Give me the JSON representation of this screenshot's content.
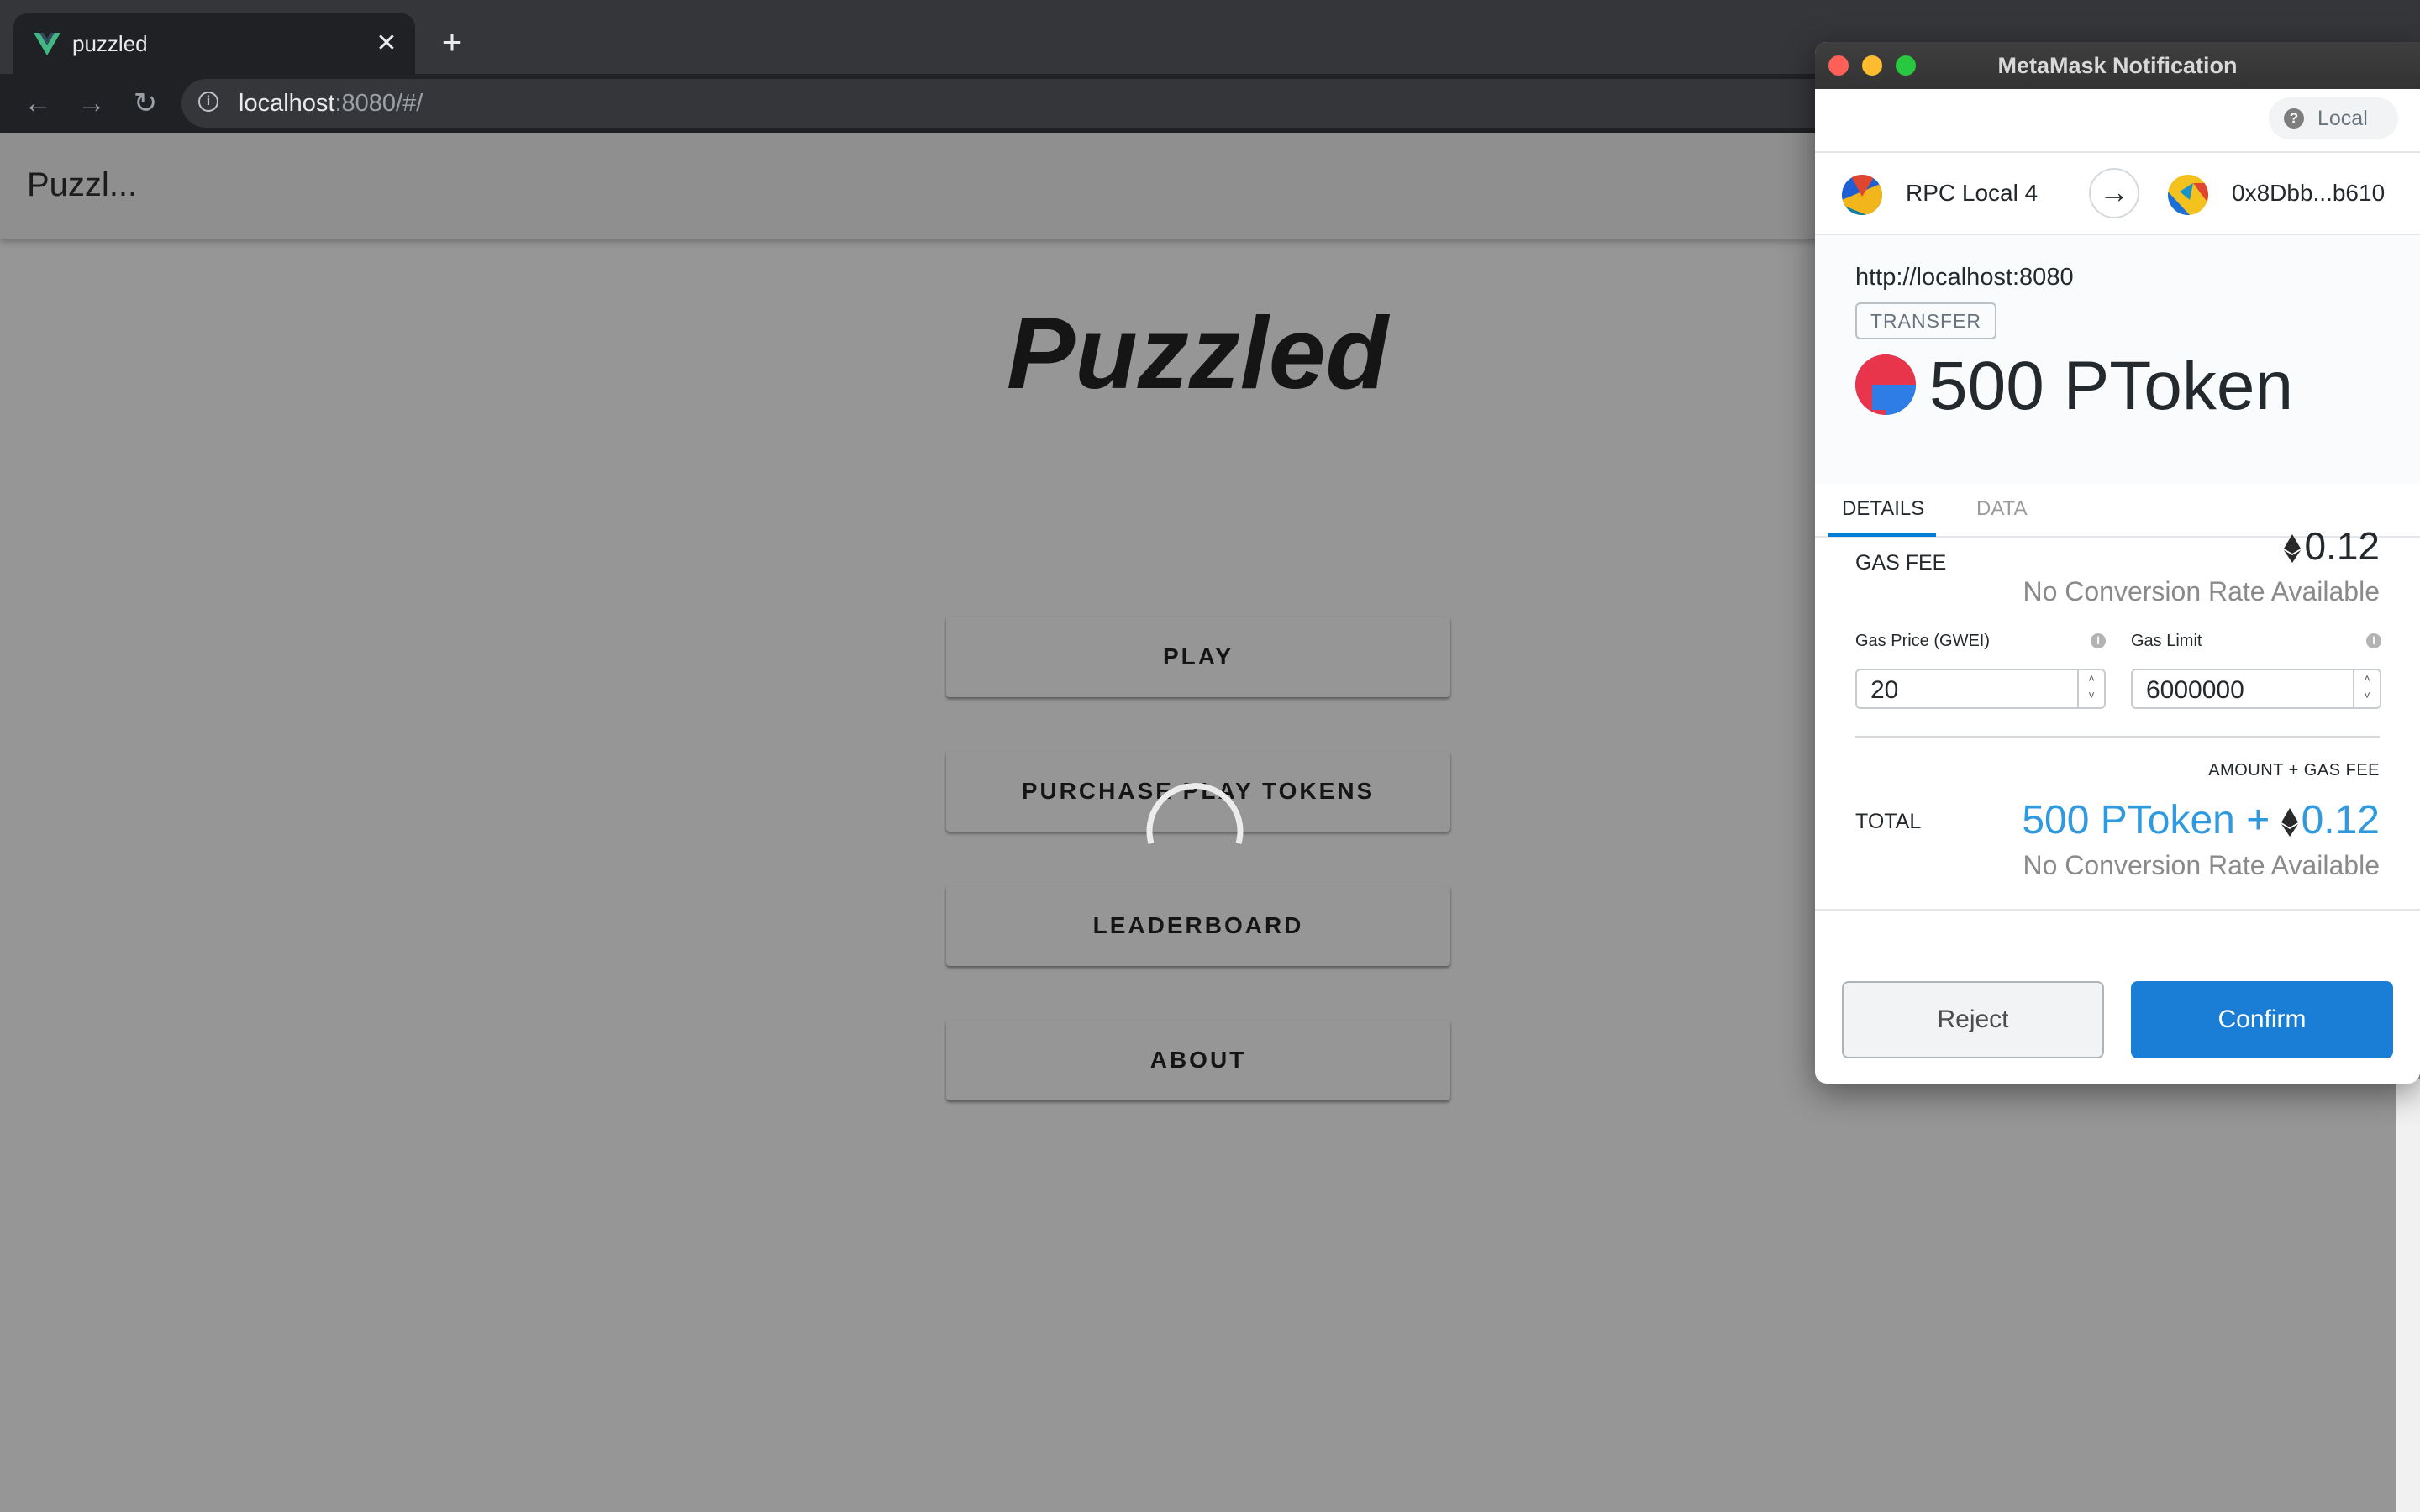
{
  "browser": {
    "tab_title": "puzzled",
    "close_glyph": "✕",
    "new_tab_glyph": "+",
    "url_host": "localhost",
    "url_rest": ":8080/#/",
    "nav": {
      "back": "←",
      "forward": "→",
      "reload": "↻"
    },
    "icons": [
      "vue-logo-icon",
      "close-icon",
      "plus-icon",
      "back-arrow-icon",
      "forward-arrow-icon",
      "reload-icon",
      "info-icon"
    ]
  },
  "page": {
    "app_bar_title": "Puzzl...",
    "hero_title": "Puzzled",
    "menu": [
      "PLAY",
      "PURCHASE PLAY TOKENS",
      "LEADERBOARD",
      "ABOUT"
    ],
    "loading": true
  },
  "metamask": {
    "window_title": "MetaMask Notification",
    "network": "Local",
    "network_icon_glyph": "?",
    "from_account": "RPC Local 4",
    "to_account": "0x8Dbb...b610",
    "arrow_glyph": "→",
    "origin": "http://localhost:8080",
    "action": "TRANSFER",
    "amount": "500 PToken",
    "tabs": [
      "DETAILS",
      "DATA"
    ],
    "active_tab": "DETAILS",
    "gas_fee_label": "GAS FEE",
    "gas_fee_value": "0.12",
    "no_conversion": "No Conversion Rate Available",
    "gas_price_label": "Gas Price (GWEI)",
    "gas_price_value": "20",
    "gas_limit_label": "Gas Limit",
    "gas_limit_value": "6000000",
    "info_glyph": "i",
    "stepper_up": "˄",
    "stepper_down": "˅",
    "amount_gas_label": "AMOUNT + GAS FEE",
    "total_label": "TOTAL",
    "total_amount": "500 PToken + ",
    "total_gas": "0.12",
    "reject_label": "Reject",
    "confirm_label": "Confirm",
    "colors": {
      "accent": "#037dd6",
      "confirm": "#1a7ed6",
      "total": "#2f9ae0"
    }
  }
}
